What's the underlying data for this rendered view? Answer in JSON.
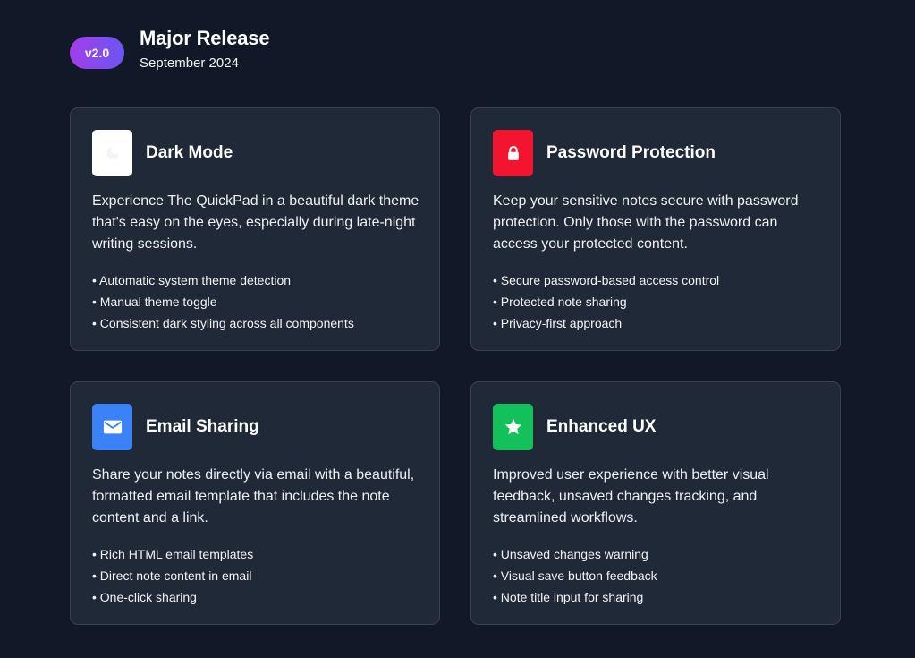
{
  "release": {
    "badge": "v2.0",
    "title": "Major Release",
    "date": "September 2024"
  },
  "features": [
    {
      "title": "Dark Mode",
      "icon": "moon-icon",
      "color": "#ffffff",
      "description": "Experience The QuickPad in a beautiful dark theme that's easy on the eyes, especially during late-night writing sessions.",
      "items": [
        "Automatic system theme detection",
        "Manual theme toggle",
        "Consistent dark styling across all components"
      ]
    },
    {
      "title": "Password Protection",
      "icon": "lock-icon",
      "color": "#f3152f",
      "description": "Keep your sensitive notes secure with password protection. Only those with the password can access your protected content.",
      "items": [
        "Secure password-based access control",
        "Protected note sharing",
        "Privacy-first approach"
      ]
    },
    {
      "title": "Email Sharing",
      "icon": "envelope-icon",
      "color": "#3b82f6",
      "description": "Share your notes directly via email with a beautiful, formatted email template that includes the note content and a link.",
      "items": [
        "Rich HTML email templates",
        "Direct note content in email",
        "One-click sharing"
      ]
    },
    {
      "title": "Enhanced UX",
      "icon": "star-icon",
      "color": "#12c15a",
      "description": "Improved user experience with better visual feedback, unsaved changes tracking, and streamlined workflows.",
      "items": [
        "Unsaved changes warning",
        "Visual save button feedback",
        "Note title input for sharing"
      ]
    }
  ]
}
